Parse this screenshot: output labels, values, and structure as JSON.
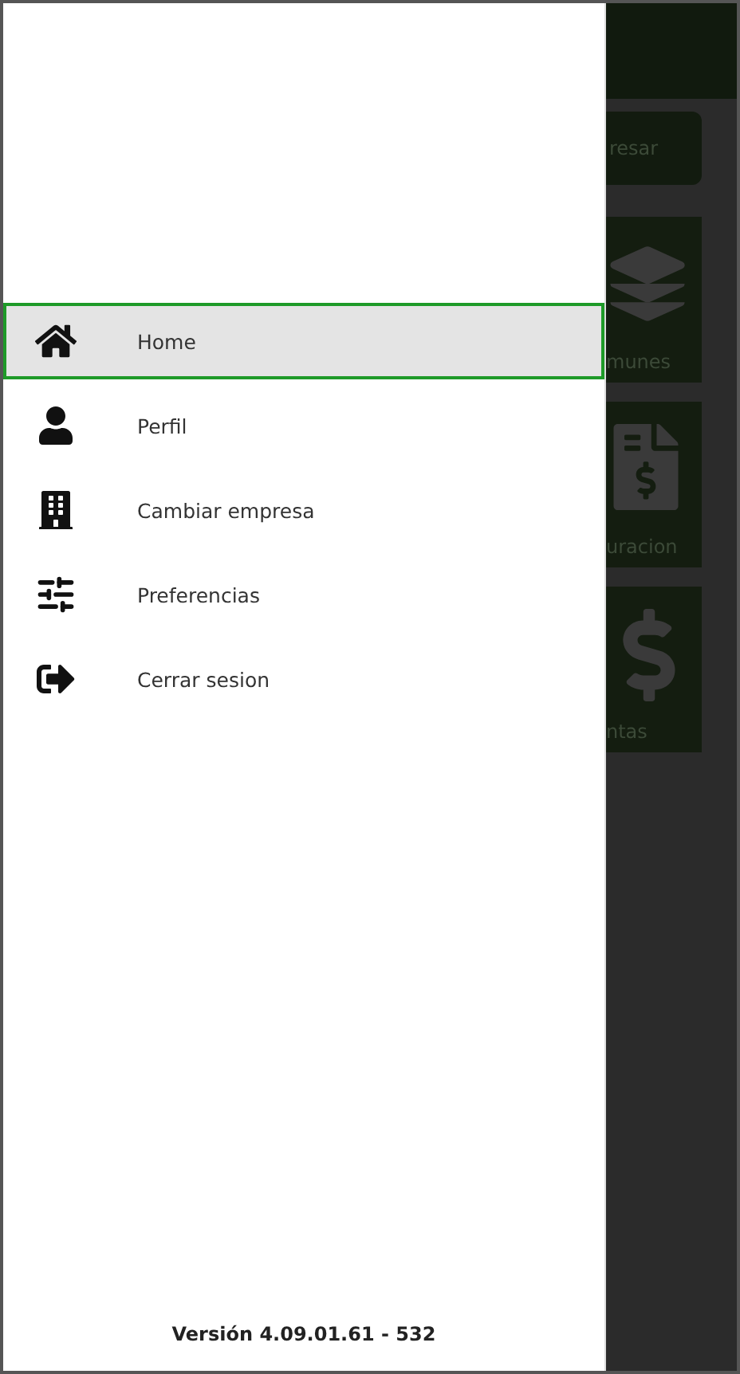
{
  "drawer": {
    "menu": [
      {
        "kind": "home",
        "label": "Home",
        "selected": true
      },
      {
        "kind": "profile",
        "label": "Perfil",
        "selected": false
      },
      {
        "kind": "company",
        "label": "Cambiar empresa",
        "selected": false
      },
      {
        "kind": "preferences",
        "label": "Preferencias",
        "selected": false
      },
      {
        "kind": "logout",
        "label": "Cerrar sesion",
        "selected": false
      }
    ],
    "version": "Versión 4.09.01.61 - 532"
  },
  "background": {
    "button": "resar",
    "tiles": [
      {
        "kind": "layers",
        "label": "munes"
      },
      {
        "kind": "invoice",
        "label": "uracion"
      },
      {
        "kind": "dollar",
        "label": "ntas"
      }
    ]
  }
}
